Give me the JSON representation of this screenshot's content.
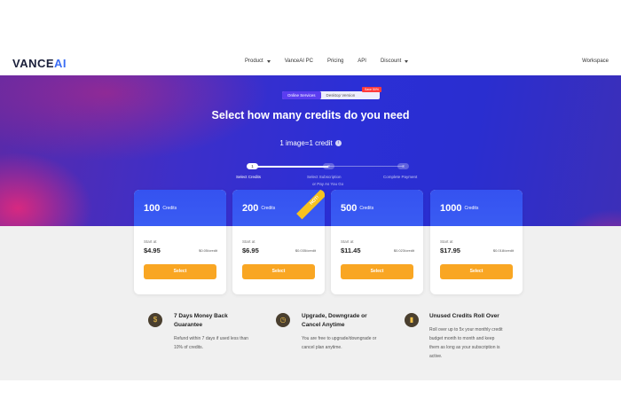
{
  "header": {
    "logo_main": "VANCE",
    "logo_ai": "AI",
    "nav": [
      {
        "label": "Product",
        "dropdown": true
      },
      {
        "label": "VanceAI PC",
        "dropdown": false
      },
      {
        "label": "Pricing",
        "dropdown": false
      },
      {
        "label": "API",
        "dropdown": false
      },
      {
        "label": "Discount",
        "dropdown": true
      }
    ],
    "workspace_label": "Workspace"
  },
  "hero": {
    "toggle": {
      "online": "Online Services",
      "desktop": "Desktop Version",
      "save_tag": "Save 50%"
    },
    "title": "Select how many credits do you need",
    "subtitle": "1 image=1 credit",
    "info_icon": "i",
    "steps": [
      {
        "num": "1",
        "label": "Select Credits",
        "active": true
      },
      {
        "num": "2",
        "label": "Select Subscription",
        "sublabel": "or Pay As You Go",
        "active": false
      },
      {
        "num": "3",
        "label": "Complete Payment",
        "active": false
      }
    ]
  },
  "plans": [
    {
      "credits": "100",
      "unit": "Credits",
      "start_at": "Start at",
      "price": "$4.95",
      "per_credit": "$0.05/credit",
      "button": "Select",
      "hot": false
    },
    {
      "credits": "200",
      "unit": "Credits",
      "start_at": "Start at",
      "price": "$6.95",
      "per_credit": "$0.035/credit",
      "button": "Select",
      "hot": true,
      "hot_label": "HOT!"
    },
    {
      "credits": "500",
      "unit": "Credits",
      "start_at": "Start at",
      "price": "$11.45",
      "per_credit": "$0.023/credit",
      "button": "Select",
      "hot": false
    },
    {
      "credits": "1000",
      "unit": "Credits",
      "start_at": "Start at",
      "price": "$17.95",
      "per_credit": "$0.018/credit",
      "button": "Select",
      "hot": false
    }
  ],
  "features": [
    {
      "icon": "money-back-icon",
      "glyph": "$",
      "title_line1": "7 Days Money Back",
      "title_line2": "Guarantee",
      "desc_line1": "Refund within 7 days if used less than",
      "desc_line2": "10% of credits."
    },
    {
      "icon": "clock-icon",
      "glyph": "◷",
      "title_line1": "Upgrade, Downgrade or",
      "title_line2": "Cancel Anytime",
      "desc_line1": "You are free to upgrade/downgrade or",
      "desc_line2": "cancel plan anytime."
    },
    {
      "icon": "chart-icon",
      "glyph": "▮",
      "title_line1": "Unused Credits Roll Over",
      "desc_line1": "Roll over up to 5x your monthly credit",
      "desc_line2": "budget month to month and keep",
      "desc_line3": "them as long as your subscription is",
      "desc_line4": "active."
    }
  ],
  "colors": {
    "accent_blue": "#3552f0",
    "button_orange": "#f9a623",
    "hot_yellow": "#f7c21f",
    "save_red": "#ff3b3b"
  }
}
